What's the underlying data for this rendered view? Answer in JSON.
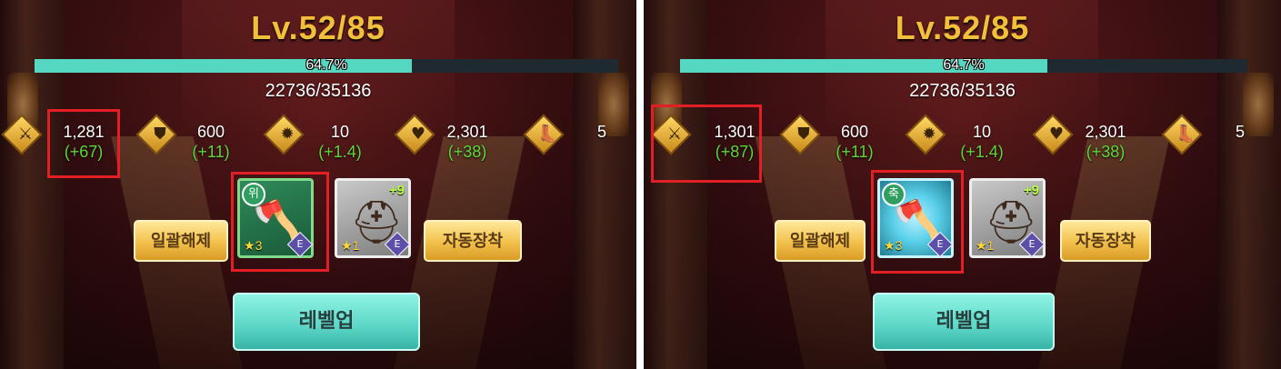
{
  "panels": [
    {
      "level": "Lv.52/85",
      "xp_percent_text": "64.7%",
      "xp_fraction": 0.647,
      "xp_count": "22736/35136",
      "stats": [
        {
          "icon": "attack-icon",
          "value": "1,281",
          "delta": "(+67)"
        },
        {
          "icon": "defense-icon",
          "value": "600",
          "delta": "(+11)"
        },
        {
          "icon": "critical-icon",
          "value": "10",
          "delta": "(+1.4)"
        },
        {
          "icon": "health-icon",
          "value": "2,301",
          "delta": "(+38)"
        },
        {
          "icon": "speed-icon",
          "value": "5",
          "delta": ""
        }
      ],
      "weapon": {
        "badge": "위",
        "stars": "3",
        "grade": "E",
        "icon": "axe-icon"
      },
      "helmet": {
        "plus": "+9",
        "stars": "1",
        "grade": "E",
        "icon": "helmet-icon"
      },
      "buttons": {
        "unequip_all": "일괄해제",
        "auto_equip": "자동장착",
        "level_up": "레벨업"
      }
    },
    {
      "level": "Lv.52/85",
      "xp_percent_text": "64.7%",
      "xp_fraction": 0.647,
      "xp_count": "22736/35136",
      "stats": [
        {
          "icon": "attack-icon",
          "value": "1,301",
          "delta": "(+87)"
        },
        {
          "icon": "defense-icon",
          "value": "600",
          "delta": "(+11)"
        },
        {
          "icon": "critical-icon",
          "value": "10",
          "delta": "(+1.4)"
        },
        {
          "icon": "health-icon",
          "value": "2,301",
          "delta": "(+38)"
        },
        {
          "icon": "speed-icon",
          "value": "5",
          "delta": ""
        }
      ],
      "weapon": {
        "badge": "축",
        "stars": "3",
        "grade": "E",
        "icon": "axe-icon"
      },
      "helmet": {
        "plus": "+9",
        "stars": "1",
        "grade": "E",
        "icon": "helmet-icon"
      },
      "buttons": {
        "unequip_all": "일괄해제",
        "auto_equip": "자동장착",
        "level_up": "레벨업"
      }
    }
  ],
  "colors": {
    "level_text": "#f2bf3a",
    "xp_fill": "#54d8c2",
    "delta_text": "#5dd63c",
    "highlight_box": "#e21f24",
    "teal_button": "#5bd6c6",
    "yellow_button": "#f2c04b"
  }
}
